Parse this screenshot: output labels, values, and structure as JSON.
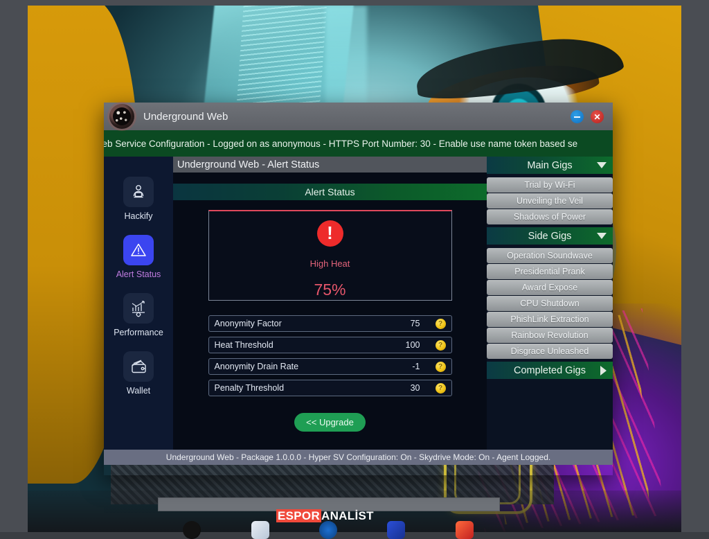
{
  "window": {
    "title": "Underground Web",
    "icon": "spider-emblem-icon",
    "minimize_label": "",
    "close_label": "✕",
    "banner": "eb - Web Service Configuration - Logged on as anonymous - HTTPS Port Number: 30 - Enable use name token based se",
    "content_title": "Underground Web - Alert Status",
    "statusbar": "Underground Web - Package 1.0.0.0 - Hyper SV Configuration: On - Skydrive Mode: On - Agent Logged."
  },
  "sidebar": {
    "items": [
      {
        "label": "Hackify",
        "icon": "hacker-laptop-icon",
        "active": false
      },
      {
        "label": "Alert Status",
        "icon": "warning-triangle-icon",
        "active": true
      },
      {
        "label": "Performance",
        "icon": "bar-chart-gear-icon",
        "active": false
      },
      {
        "label": "Wallet",
        "icon": "wallet-icon",
        "active": false
      }
    ]
  },
  "main": {
    "section_title": "Alert Status",
    "alert": {
      "icon": "exclamation-circle-icon",
      "glyph": "!",
      "label": "High Heat",
      "value": "75%"
    },
    "stats": [
      {
        "name": "Anonymity Factor",
        "value": "75",
        "coin": "?"
      },
      {
        "name": "Heat Threshold",
        "value": "100",
        "coin": "?"
      },
      {
        "name": "Anonymity Drain Rate",
        "value": "-1",
        "coin": "?"
      },
      {
        "name": "Penalty Threshold",
        "value": "30",
        "coin": "?"
      }
    ],
    "upgrade_label": "<< Upgrade"
  },
  "gigs": {
    "main": {
      "header": "Main Gigs",
      "state": "expanded",
      "items": [
        "Trial by Wi-Fi",
        "Unveiling the Veil",
        "Shadows of Power"
      ]
    },
    "side": {
      "header": "Side Gigs",
      "state": "expanded",
      "items": [
        "Operation Soundwave",
        "Presidential Prank",
        "Award Expose",
        "CPU Shutdown",
        "PhishLink Extraction",
        "Rainbow Revolution",
        "Disgrace Unleashed"
      ]
    },
    "completed": {
      "header": "Completed Gigs",
      "state": "collapsed"
    }
  },
  "desktop": {
    "watermark": {
      "highlight": "ESPOR",
      "rest": "ANALİST"
    }
  },
  "colors": {
    "accent_green": "#0d6b2b",
    "alert_red": "#ee2b2b",
    "active_blue": "#3b45f0",
    "coin_gold": "#f0c417",
    "upgrade_green": "#1f9e54"
  }
}
